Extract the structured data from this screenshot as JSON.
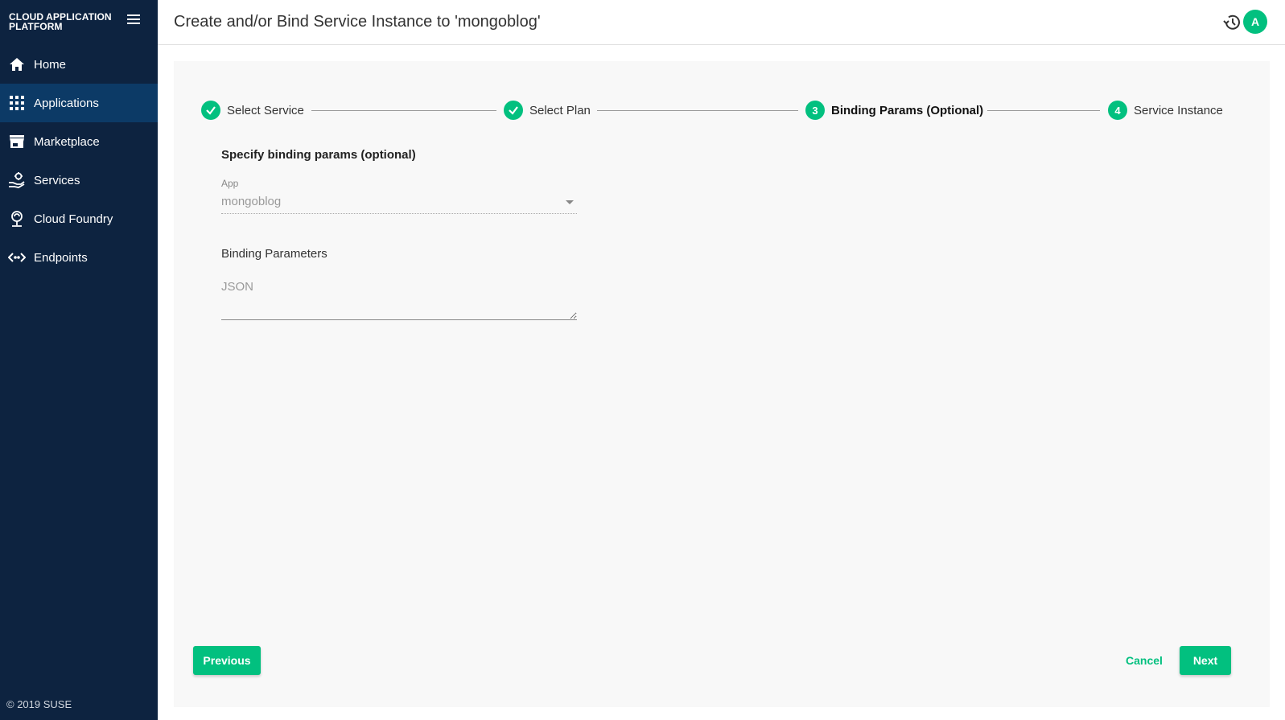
{
  "sidebar": {
    "brand": "CLOUD APPLICATION PLATFORM",
    "items": [
      {
        "label": "Home",
        "icon": "home-icon"
      },
      {
        "label": "Applications",
        "icon": "apps-grid-icon",
        "active": true
      },
      {
        "label": "Marketplace",
        "icon": "store-icon"
      },
      {
        "label": "Services",
        "icon": "service-hand-icon"
      },
      {
        "label": "Cloud Foundry",
        "icon": "cloud-foundry-icon"
      },
      {
        "label": "Endpoints",
        "icon": "code-arrows-icon"
      }
    ],
    "copyright": "© 2019 SUSE"
  },
  "header": {
    "title": "Create and/or Bind Service Instance to 'mongoblog'",
    "avatar_initial": "A"
  },
  "stepper": {
    "steps": [
      {
        "label": "Select Service",
        "state": "done"
      },
      {
        "label": "Select Plan",
        "state": "done"
      },
      {
        "label": "Binding Params (Optional)",
        "state": "current",
        "number": "3"
      },
      {
        "label": "Service Instance",
        "state": "todo",
        "number": "4"
      }
    ]
  },
  "form": {
    "heading": "Specify binding params (optional)",
    "app_label": "App",
    "app_value": "mongoblog",
    "binding_label": "Binding Parameters",
    "json_placeholder": "JSON"
  },
  "actions": {
    "previous": "Previous",
    "cancel": "Cancel",
    "next": "Next"
  },
  "colors": {
    "sidebar_bg": "#0d2340",
    "sidebar_active": "#0c3a66",
    "accent": "#02c07f"
  }
}
